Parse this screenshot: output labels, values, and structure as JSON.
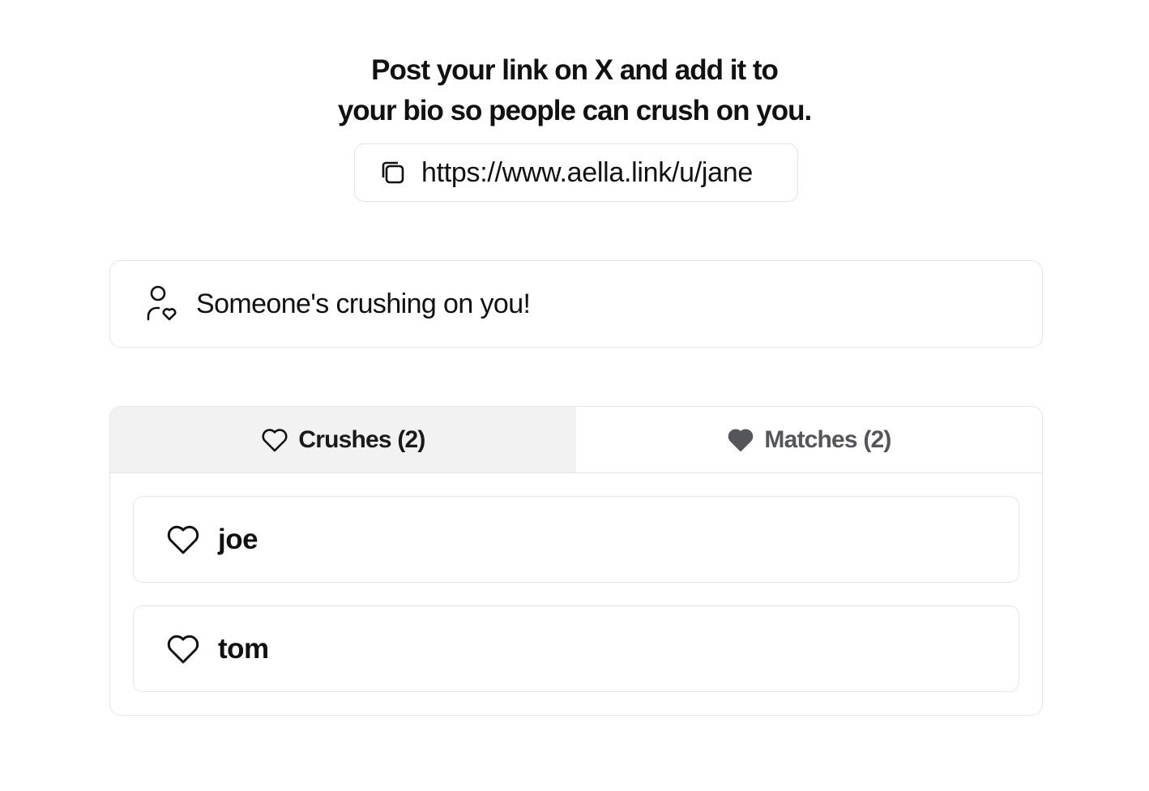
{
  "header": {
    "line1": "Post your link on X and add it to",
    "line2": "your bio so people can crush on you."
  },
  "share_link": {
    "url": "https://www.aella.link/u/jane",
    "icon": "copy-icon"
  },
  "notice": {
    "text": "Someone's crushing on you!",
    "icon": "user-heart-icon"
  },
  "tabs": [
    {
      "label": "Crushes (2)",
      "icon": "heart-outline-icon",
      "active": true
    },
    {
      "label": "Matches (2)",
      "icon": "heart-filled-icon",
      "active": false
    }
  ],
  "crushes": [
    {
      "name": "joe",
      "icon": "heart-outline-icon"
    },
    {
      "name": "tom",
      "icon": "heart-outline-icon"
    }
  ],
  "colors": {
    "text": "#111111",
    "border": "#e6e6e6",
    "active_tab_bg": "#f2f2f2",
    "inactive_tab_text": "#55555c"
  }
}
